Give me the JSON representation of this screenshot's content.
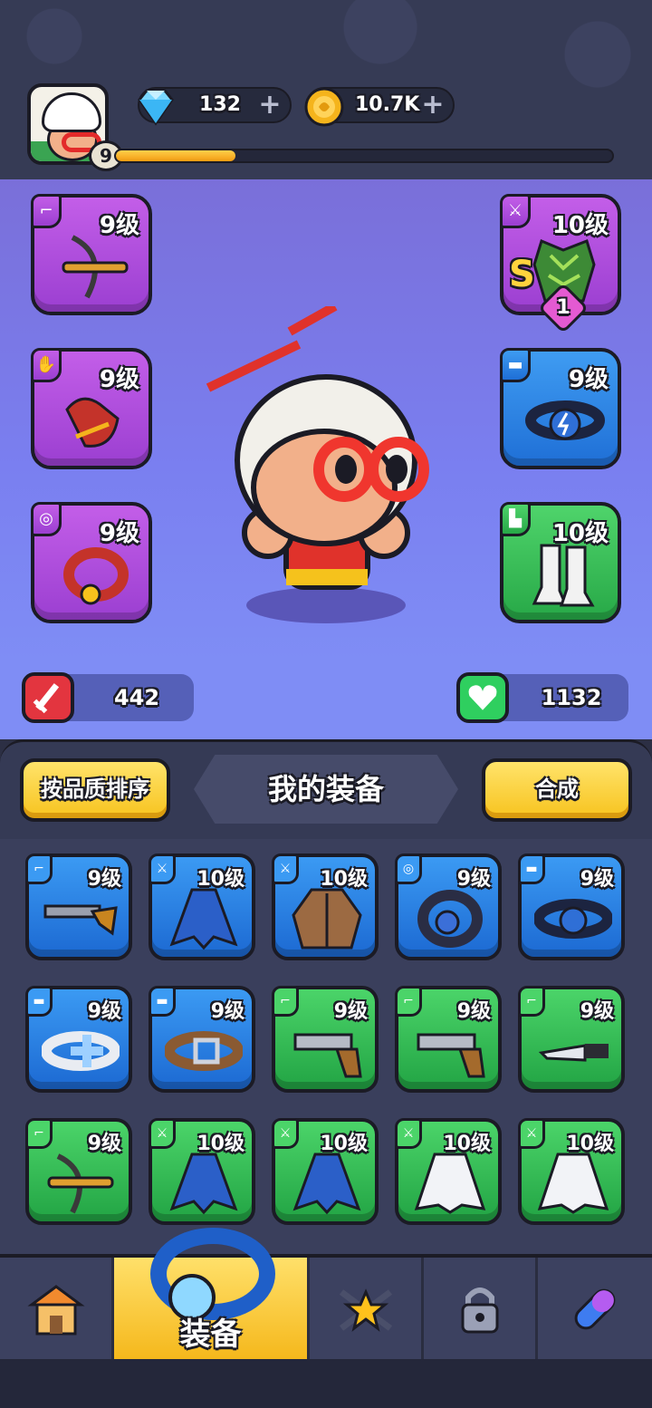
{
  "player": {
    "level": "9",
    "xp_fraction": 0.24
  },
  "currency": {
    "gems": "132",
    "coins": "10.7K",
    "gem_icon": "diamond-icon",
    "coin_icon": "gold-coin-icon"
  },
  "equipped_left": [
    {
      "name": "crossbow",
      "level": "9级",
      "rarity": "purple",
      "category": "weapon-icon"
    },
    {
      "name": "gloves",
      "level": "9级",
      "rarity": "purple",
      "category": "glove-icon"
    },
    {
      "name": "ring",
      "level": "9级",
      "rarity": "purple",
      "category": "ring-icon"
    }
  ],
  "equipped_right": [
    {
      "name": "leaf-armor",
      "level": "10级",
      "rarity": "purple",
      "category": "armor-icon",
      "grade": "S",
      "stars": "1"
    },
    {
      "name": "belt",
      "level": "9级",
      "rarity": "blue",
      "category": "belt-icon"
    },
    {
      "name": "boots",
      "level": "10级",
      "rarity": "green",
      "category": "boot-icon"
    }
  ],
  "stats": {
    "attack": "442",
    "health": "1132"
  },
  "inventory_header": {
    "sort_label": "按品质排序",
    "title": "我的装备",
    "merge_label": "合成"
  },
  "inventory": [
    {
      "item": "shotgun",
      "level": "9级",
      "rarity": "blue",
      "category": "weapon-icon"
    },
    {
      "item": "blue-cape",
      "level": "10级",
      "rarity": "blue",
      "category": "armor-icon"
    },
    {
      "item": "brown-jacket",
      "level": "10级",
      "rarity": "blue",
      "category": "armor-icon"
    },
    {
      "item": "ring",
      "level": "9级",
      "rarity": "blue",
      "category": "ring-icon"
    },
    {
      "item": "belt",
      "level": "9级",
      "rarity": "blue",
      "category": "belt-icon"
    },
    {
      "item": "white-belt",
      "level": "9级",
      "rarity": "blue",
      "category": "belt-icon"
    },
    {
      "item": "leather-belt",
      "level": "9级",
      "rarity": "blue",
      "category": "belt-icon"
    },
    {
      "item": "pistol",
      "level": "9级",
      "rarity": "green",
      "category": "weapon-icon"
    },
    {
      "item": "pistol",
      "level": "9级",
      "rarity": "green",
      "category": "weapon-icon"
    },
    {
      "item": "knife",
      "level": "9级",
      "rarity": "green",
      "category": "weapon-icon"
    },
    {
      "item": "crossbow",
      "level": "9级",
      "rarity": "green",
      "category": "weapon-icon"
    },
    {
      "item": "blue-cape",
      "level": "10级",
      "rarity": "green",
      "category": "armor-icon"
    },
    {
      "item": "blue-cape",
      "level": "10级",
      "rarity": "green",
      "category": "armor-icon"
    },
    {
      "item": "white-coat",
      "level": "10级",
      "rarity": "green",
      "category": "armor-icon"
    },
    {
      "item": "white-coat",
      "level": "10级",
      "rarity": "green",
      "category": "armor-icon"
    }
  ],
  "nav": [
    {
      "id": "shop",
      "icon": "shop-icon"
    },
    {
      "id": "equip",
      "icon": "ring-icon",
      "label": "装备",
      "active": true
    },
    {
      "id": "talent",
      "icon": "star-weapons-icon"
    },
    {
      "id": "locked",
      "icon": "lock-icon"
    },
    {
      "id": "skills",
      "icon": "capsule-icon"
    }
  ],
  "colors": {
    "purple": "#b04fe0",
    "blue": "#2f86e8",
    "green": "#39c157",
    "accent_yellow": "#f7c31e",
    "attack_red": "#e3353f",
    "health_green": "#2fcf5f"
  }
}
